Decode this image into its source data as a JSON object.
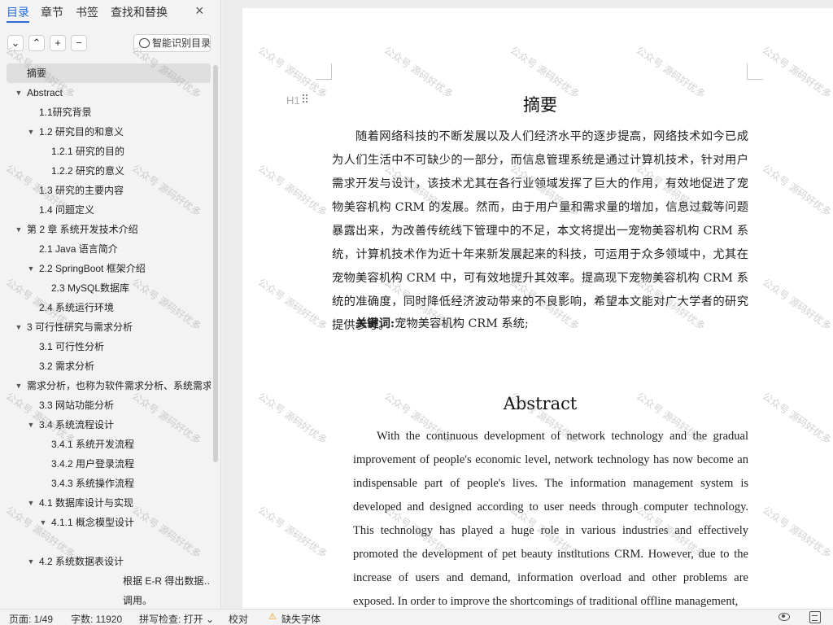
{
  "sidebar": {
    "tabs": [
      "目录",
      "章节",
      "书签",
      "查找和替换"
    ],
    "close": "×",
    "toolbar": {
      "collapse": "⌄",
      "expand": "⌃",
      "add": "+",
      "remove": "−",
      "smart": "智能识别目录"
    },
    "toc": [
      {
        "label": "摘要",
        "level": 0,
        "caret": false,
        "selected": true
      },
      {
        "label": "Abstract",
        "level": 0,
        "caret": true
      },
      {
        "label": "1.1研究背景",
        "level": 1,
        "caret": false
      },
      {
        "label": "1.2  研究目的和意义",
        "level": 1,
        "caret": true
      },
      {
        "label": "1.2.1  研究的目的",
        "level": 2,
        "caret": false
      },
      {
        "label": "1.2.2  研究的意义",
        "level": 2,
        "caret": false
      },
      {
        "label": "1.3  研究的主要内容",
        "level": 1,
        "caret": false
      },
      {
        "label": "1.4  问题定义",
        "level": 1,
        "caret": false
      },
      {
        "label": "第 2 章    系统开发技术介绍",
        "level": 0,
        "caret": true
      },
      {
        "label": "2.1 Java 语言简介",
        "level": 1,
        "caret": false
      },
      {
        "label": "2.2 SpringBoot 框架介绍",
        "level": 1,
        "caret": true
      },
      {
        "label": "2.3     MySQL数据库",
        "level": 2,
        "caret": false
      },
      {
        "label": "2.4     系统运行环境",
        "level": 1,
        "caret": false
      },
      {
        "label": "3  可行性研究与需求分析",
        "level": 0,
        "caret": true
      },
      {
        "label": "3.1 可行性分析",
        "level": 1,
        "caret": false
      },
      {
        "label": "3.2  需求分析",
        "level": 1,
        "caret": false
      },
      {
        "label": "需求分析，也称为软件需求分析、系统需求…",
        "level": 0,
        "caret": true
      },
      {
        "label": "3.3 网站功能分析",
        "level": 1,
        "caret": false
      },
      {
        "label": "3.4 系统流程设计",
        "level": 1,
        "caret": true
      },
      {
        "label": "3.4.1  系统开发流程",
        "level": 2,
        "caret": false
      },
      {
        "label": "3.4.2  用户登录流程",
        "level": 2,
        "caret": false
      },
      {
        "label": "3.4.3   系统操作流程",
        "level": 2,
        "caret": false
      },
      {
        "label": "4.1  数据库设计与实现",
        "level": 1,
        "caret": true
      },
      {
        "label": "4.1.1  概念模型设计",
        "level": 2,
        "caret": true
      },
      {
        "label": "",
        "level": 2,
        "caret": false
      },
      {
        "label": "4.2  系统数据表设计",
        "level": 1,
        "caret": true
      },
      {
        "label": "根据 E-R 得出数据…",
        "level": 4,
        "caret": false
      },
      {
        "label": "调用。",
        "level": 4,
        "caret": false
      }
    ]
  },
  "document": {
    "heading_mark": "H1",
    "drag_mark": "⠿",
    "title_cn": "摘要",
    "para_cn": "随着网络科技的不断发展以及人们经济水平的逐步提高，网络技术如今已成为人们生活中不可缺少的一部分，而信息管理系统是通过计算机技术，针对用户需求开发与设计，该技术尤其在各行业领域发挥了巨大的作用，有效地促进了宠物美容机构 CRM 的发展。然而，由于用户量和需求量的增加，信息过载等问题暴露出来，为改善传统线下管理中的不足，本文将提出一宠物美容机构 CRM 系统，计算机技术作为近十年来新发展起来的科技，可运用于众多领域中，尤其在宠物美容机构 CRM 中，可有效地提升其效率。提高现下宠物美容机构 CRM 系统的准确度，同时降低经济波动带来的不良影响，希望本文能对广大学者的研究提供参考。",
    "keywords_label": "关键词:",
    "keywords_value": "宠物美容机构 CRM 系统;",
    "title_en": "Abstract",
    "para_en": "With the continuous development of network technology and the gradual improvement of people's economic level, network technology has now become an indispensable part of people's lives. The information management system is developed and designed according to user needs through computer technology. This technology has played a huge role in various industries and effectively promoted the development of pet beauty institutions CRM. However, due to the increase of users and demand, information overload and other problems are exposed. In order to improve the shortcomings of traditional offline management,",
    "watermark": "公众号 源码好优多"
  },
  "status": {
    "page": "页面: 1/49",
    "words": "字数: 11920",
    "spell": "拼写检查: 打开",
    "spell_caret": "⌄",
    "proof": "校对",
    "missing_font": "缺失字体",
    "warn_glyph": "⚠"
  },
  "colors": {
    "accent": "#2a6bd8",
    "warning": "#e8a200"
  }
}
